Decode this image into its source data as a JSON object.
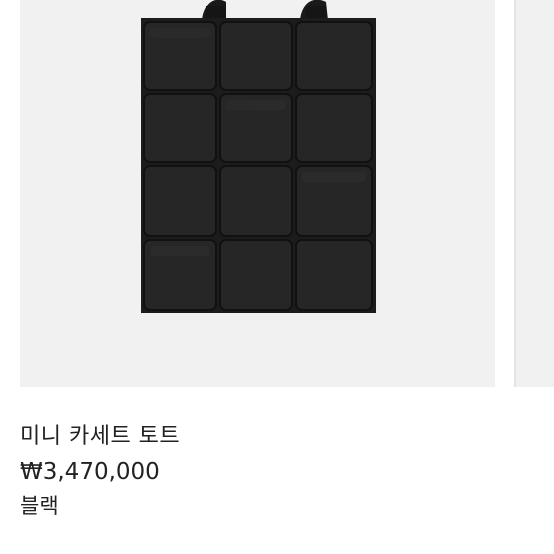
{
  "product": {
    "name": "미니 카세트 토트",
    "price": "₩3,470,000",
    "color": "블랙",
    "image_alt": "black woven leather tote bag"
  },
  "colors": {
    "card_bg": "#f1f1f1",
    "bag": "#1f1f1f",
    "text": "#222222"
  }
}
